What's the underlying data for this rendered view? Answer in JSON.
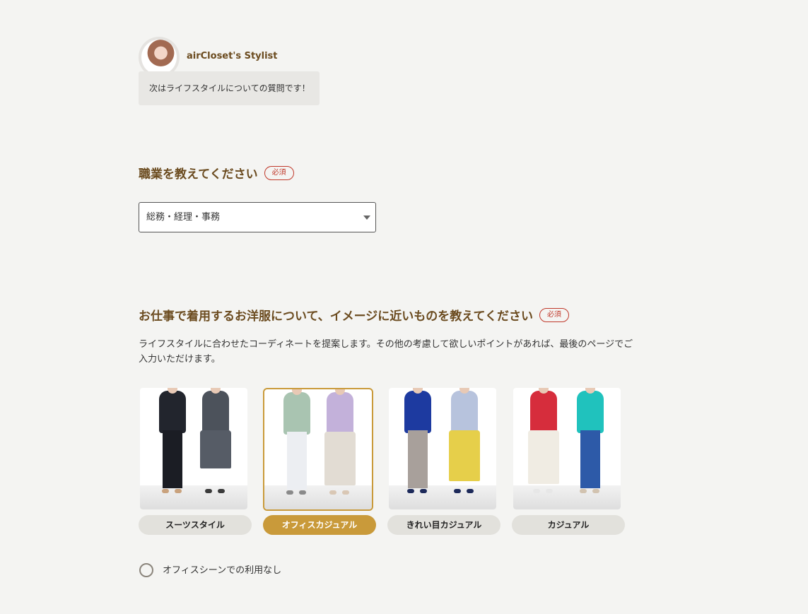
{
  "stylist": {
    "name": "airCloset's Stylist",
    "message": "次はライフスタイルについての質問です！"
  },
  "occupation_question": {
    "title": "職業を教えてください",
    "required_label": "必須",
    "selected_value": "総務・経理・事務"
  },
  "workwear_question": {
    "title": "お仕事で着用するお洋服について、イメージに近いものを教えてください",
    "required_label": "必須",
    "description": "ライフスタイルに合わせたコーディネートを提案します。その他の考慮して欲しいポイントがあれば、最後のページでご入力いただけます。",
    "options": [
      {
        "label": "スーツスタイル",
        "selected": false
      },
      {
        "label": "オフィスカジュアル",
        "selected": true
      },
      {
        "label": "きれい目カジュアル",
        "selected": false
      },
      {
        "label": "カジュアル",
        "selected": false
      }
    ],
    "none_option_label": "オフィスシーンでの利用なし"
  },
  "colors": {
    "accent": "#c99a3a",
    "heading": "#6b4b1f",
    "required": "#c0392b",
    "background": "#f4f4f2"
  }
}
